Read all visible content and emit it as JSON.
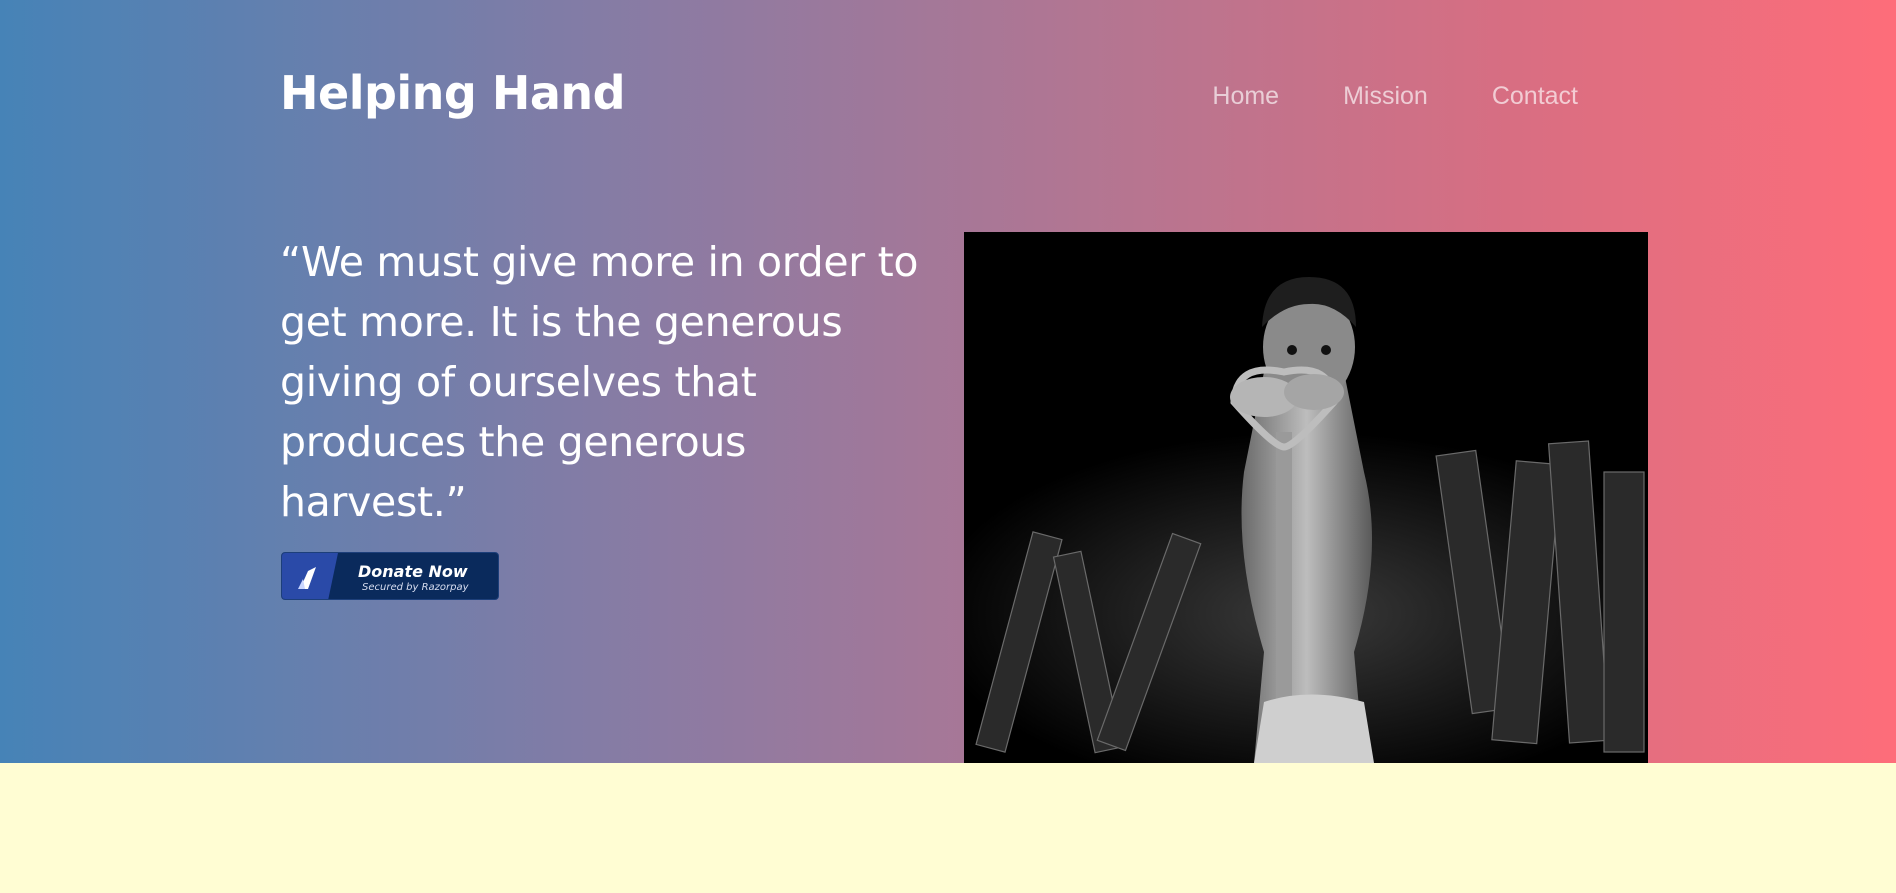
{
  "header": {
    "brand": "Helping Hand",
    "nav": [
      {
        "label": "Home"
      },
      {
        "label": "Mission"
      },
      {
        "label": "Contact"
      }
    ]
  },
  "hero": {
    "quote": "“We must give more in order to get more. It is the generous giving of ourselves that produces the generous harvest.”",
    "donate_button": {
      "label": "Donate Now",
      "sublabel": "Secured by Razorpay"
    }
  },
  "colors": {
    "gradient_start": "#4683b7",
    "gradient_end": "#fe6d7a",
    "footer_background": "#fffdd3",
    "donate_background": "#0a2a5c"
  }
}
